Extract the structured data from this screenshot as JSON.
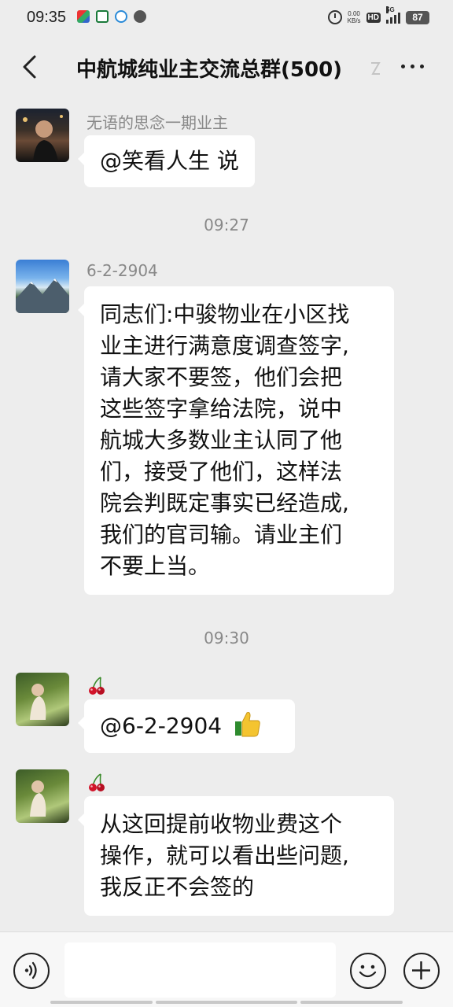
{
  "status_bar": {
    "time": "09:35",
    "net_speed_value": "0.00",
    "net_speed_unit": "KB/s",
    "hd_label": "HD",
    "signal_label": "5G",
    "battery": "87"
  },
  "header": {
    "title": "中航城纯业主交流总群(500)"
  },
  "messages": [
    {
      "sender": "无语的思念一期业主",
      "text": "@笑看人生  说"
    },
    {
      "time": "09:27"
    },
    {
      "sender": "6-2-2904",
      "lines": [
        "同志们:中骏物业在小区找",
        "业主进行满意度调查签字,",
        "请大家不要签，他们会把",
        "这些签字拿给法院，说中",
        "航城大多数业主认同了他",
        "们，接受了他们，这样法",
        "院会判既定事实已经造成,",
        "我们的官司输。请业主们",
        "不要上当。"
      ]
    },
    {
      "time": "09:30"
    },
    {
      "sender_icon": "cherry-icon",
      "text": "@6-2-2904",
      "trailing_icon": "thumbs-up-icon"
    },
    {
      "sender_icon": "cherry-icon",
      "lines": [
        "从这回提前收物业费这个",
        "操作，就可以看出些问题,",
        "我反正不会签的"
      ]
    }
  ],
  "input_bar": {
    "input_value": "",
    "icons": [
      "voice-icon",
      "emoji-icon",
      "plus-icon"
    ]
  }
}
